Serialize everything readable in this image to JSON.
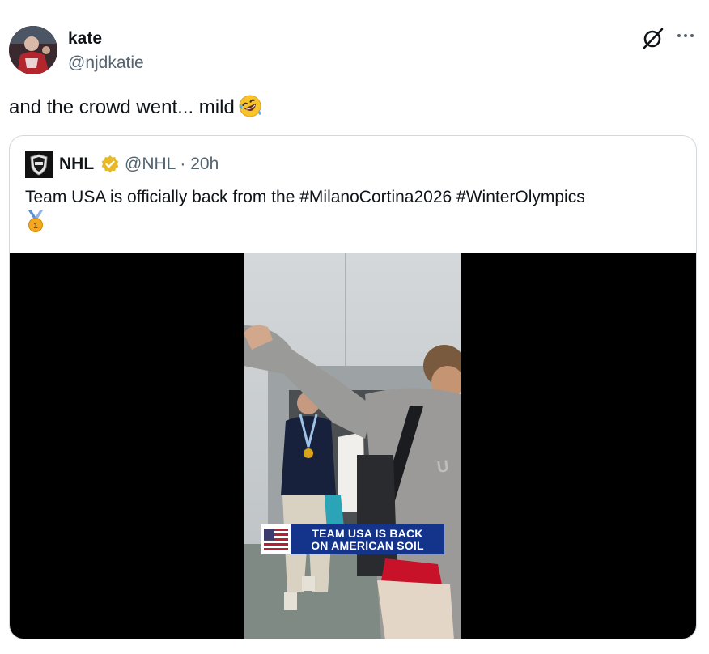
{
  "author": {
    "name": "kate",
    "handle": "@njdkatie"
  },
  "tweet": {
    "text": "and the crowd went... mild",
    "emoji": "rolling-on-floor-laughing-emoji"
  },
  "quoted_tweet": {
    "name": "NHL",
    "handle": "@NHL · 20h",
    "text": "Team USA is officially back from the #MilanoCortina2026 #WinterOlympics",
    "emoji": "gold-medal-emoji",
    "media": {
      "chyron_line1": "TEAM USA IS BACK",
      "chyron_line2": "ON AMERICAN SOIL"
    }
  },
  "icons": {
    "grok": "grok-icon",
    "more": "more-icon",
    "verified": "verified-badge-icon"
  },
  "colors": {
    "text": "#0f1419",
    "secondary": "#536471",
    "border": "#cfd9de",
    "verified_gold": "#e8b829",
    "chyron_blue": "#14348c"
  }
}
